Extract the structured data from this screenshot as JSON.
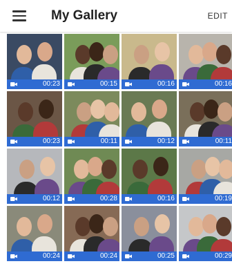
{
  "header": {
    "title": "My Gallery",
    "edit_label": "EDIT"
  },
  "gallery": {
    "bar_color": "#2f6bd2",
    "items": [
      {
        "duration": "00:23",
        "bg": "#3a4a63",
        "icon": "video-camera-icon"
      },
      {
        "duration": "00:15",
        "bg": "#7a9c5a",
        "icon": "video-camera-icon"
      },
      {
        "duration": "00:16",
        "bg": "#c9b98c",
        "icon": "video-camera-icon"
      },
      {
        "duration": "00:16",
        "bg": "#b8b4ac",
        "icon": "video-camera-icon"
      },
      {
        "duration": "00:23",
        "bg": "#6b5646",
        "icon": "video-camera-icon"
      },
      {
        "duration": "00:11",
        "bg": "#7c8a5c",
        "icon": "video-camera-icon"
      },
      {
        "duration": "00:12",
        "bg": "#6a7a54",
        "icon": "video-camera-icon"
      },
      {
        "duration": "00:11",
        "bg": "#7a6f5a",
        "icon": "video-camera-icon"
      },
      {
        "duration": "00:12",
        "bg": "#b6b8bc",
        "icon": "video-camera-icon"
      },
      {
        "duration": "00:28",
        "bg": "#6f8a54",
        "icon": "video-camera-icon"
      },
      {
        "duration": "00:16",
        "bg": "#5c7848",
        "icon": "video-camera-icon"
      },
      {
        "duration": "00:19",
        "bg": "#a7a8a4",
        "icon": "video-camera-icon"
      },
      {
        "duration": "00:24",
        "bg": "#8a8a7a",
        "icon": "video-camera-icon"
      },
      {
        "duration": "00:24",
        "bg": "#866a55",
        "icon": "video-camera-icon"
      },
      {
        "duration": "00:25",
        "bg": "#8a8f9c",
        "icon": "video-camera-icon"
      },
      {
        "duration": "00:29",
        "bg": "#c5c7c9",
        "icon": "video-camera-icon"
      }
    ]
  }
}
